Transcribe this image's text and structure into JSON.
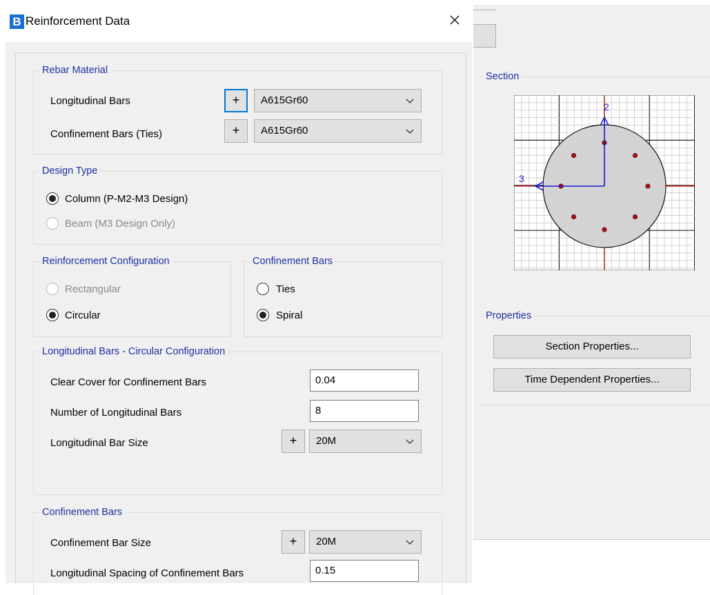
{
  "dialog": {
    "app_icon_letter": "B",
    "title": "Reinforcement Data"
  },
  "rebar_material": {
    "legend": "Rebar Material",
    "longitudinal_label": "Longitudinal Bars",
    "longitudinal_value": "A615Gr60",
    "confinement_label": "Confinement Bars  (Ties)",
    "confinement_value": "A615Gr60",
    "plus_label": "+"
  },
  "design_type": {
    "legend": "Design Type",
    "column_label": "Column  (P-M2-M3 Design)",
    "beam_label": "Beam  (M3 Design Only)",
    "selected": "column"
  },
  "reinforcement_configuration": {
    "legend": "Reinforcement Configuration",
    "rectangular_label": "Rectangular",
    "circular_label": "Circular",
    "selected": "circular"
  },
  "confinement_type": {
    "legend": "Confinement Bars",
    "ties_label": "Ties",
    "spiral_label": "Spiral",
    "selected": "spiral"
  },
  "circular_config": {
    "legend": "Longitudinal Bars - Circular Configuration",
    "clear_cover_label": "Clear Cover for Confinement Bars",
    "clear_cover_value": "0.04",
    "num_bars_label": "Number of Longitudinal Bars",
    "num_bars_value": "8",
    "bar_size_label": "Longitudinal Bar Size",
    "bar_size_value": "20M"
  },
  "confinement_bars": {
    "legend": "Confinement Bars",
    "bar_size_label": "Confinement Bar Size",
    "bar_size_value": "20M",
    "spacing_label": "Longitudinal Spacing of Confinement Bars",
    "spacing_value": "0.15"
  },
  "section_preview": {
    "legend": "Section",
    "axis_2_label": "2",
    "axis_3_label": "3",
    "rebar_count": 8,
    "colors": {
      "section_fill": "#d3d3d3",
      "rebar": "#b01010",
      "axis_blue": "#1a1acc",
      "axis_red": "#e01010",
      "grid": "#b8b8b8"
    }
  },
  "properties": {
    "legend": "Properties",
    "section_properties_button": "Section Properties...",
    "time_dependent_button": "Time Dependent Properties..."
  },
  "colors": {
    "legend_text": "#1f2fa0",
    "dialog_bg": "#f0f0f0",
    "focus_border": "#0078d7"
  }
}
